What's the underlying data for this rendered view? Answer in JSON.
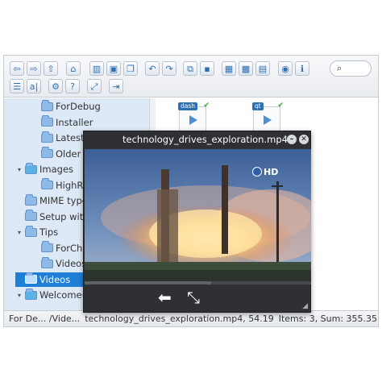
{
  "toolbar": {
    "row1": [
      {
        "name": "back",
        "glyph": "⇦"
      },
      {
        "name": "forward",
        "glyph": "⇨"
      },
      {
        "name": "up",
        "glyph": "⇧"
      },
      {
        "name": "home",
        "glyph": "⌂"
      },
      {
        "name": "panes",
        "glyph": "▥"
      },
      {
        "name": "save",
        "glyph": "▣"
      },
      {
        "name": "open",
        "glyph": "❐"
      },
      {
        "name": "undo",
        "glyph": "↶"
      },
      {
        "name": "redo",
        "glyph": "↷"
      },
      {
        "name": "copy",
        "glyph": "⧉"
      },
      {
        "name": "select",
        "glyph": "▪"
      },
      {
        "name": "grid-large",
        "glyph": "▦"
      },
      {
        "name": "grid-small",
        "glyph": "▩"
      },
      {
        "name": "grid-alt",
        "glyph": "▤"
      },
      {
        "name": "preview",
        "glyph": "◉"
      },
      {
        "name": "info",
        "glyph": "ℹ"
      }
    ],
    "row2": [
      {
        "name": "list",
        "glyph": "☰"
      },
      {
        "name": "rename",
        "glyph": "a|"
      },
      {
        "name": "settings",
        "glyph": "⚙"
      },
      {
        "name": "help",
        "glyph": "?"
      },
      {
        "name": "expand",
        "glyph": "⤢"
      },
      {
        "name": "export",
        "glyph": "⇥"
      }
    ],
    "search_glyph": "⌕"
  },
  "tree": {
    "items": [
      {
        "label": "ForDebug",
        "indent": 2,
        "caret": "",
        "selected": false,
        "globe": false
      },
      {
        "label": "Installer",
        "indent": 2,
        "caret": "",
        "selected": false,
        "globe": false
      },
      {
        "label": "Latest Nightly",
        "indent": 2,
        "caret": "",
        "selected": false,
        "globe": false
      },
      {
        "label": "Older",
        "indent": 2,
        "caret": "",
        "selected": false,
        "globe": false
      },
      {
        "label": "Images",
        "indent": 1,
        "caret": "▾",
        "selected": false,
        "globe": true
      },
      {
        "label": "HighResolution",
        "indent": 2,
        "caret": "",
        "selected": false,
        "globe": false
      },
      {
        "label": "MIME types",
        "indent": 1,
        "caret": "",
        "selected": false,
        "globe": false
      },
      {
        "label": "Setup with",
        "indent": 1,
        "caret": "",
        "selected": false,
        "globe": false
      },
      {
        "label": "Tips",
        "indent": 1,
        "caret": "▾",
        "selected": false,
        "globe": false
      },
      {
        "label": "ForChecking",
        "indent": 2,
        "caret": "",
        "selected": false,
        "globe": false
      },
      {
        "label": "Videos",
        "indent": 2,
        "caret": "",
        "selected": false,
        "globe": false
      },
      {
        "label": "Videos",
        "indent": 1,
        "caret": "",
        "selected": true,
        "globe": false
      },
      {
        "label": "Welcome(Multilingual)",
        "indent": 1,
        "caret": "▾",
        "selected": false,
        "globe": true
      }
    ]
  },
  "files": [
    {
      "tag": "dash"
    },
    {
      "tag": "qt"
    }
  ],
  "player": {
    "title": "technology_drives_exploration.mp4",
    "hd_badge": "HD",
    "minimize_glyph": "–",
    "close_glyph": "✕",
    "back_glyph": "➡",
    "fullscreen_glyph": "⤡",
    "progress": 0.56
  },
  "statusbar": {
    "path": "For De... /Vide...",
    "file": "technology_drives_exploration.mp4, 54.19",
    "items": "Items: 3, Sum: 355.35"
  },
  "colors": {
    "selection": "#1f7fd6",
    "tree_bg": "#dde9f6",
    "player_bg": "#2e3034"
  }
}
